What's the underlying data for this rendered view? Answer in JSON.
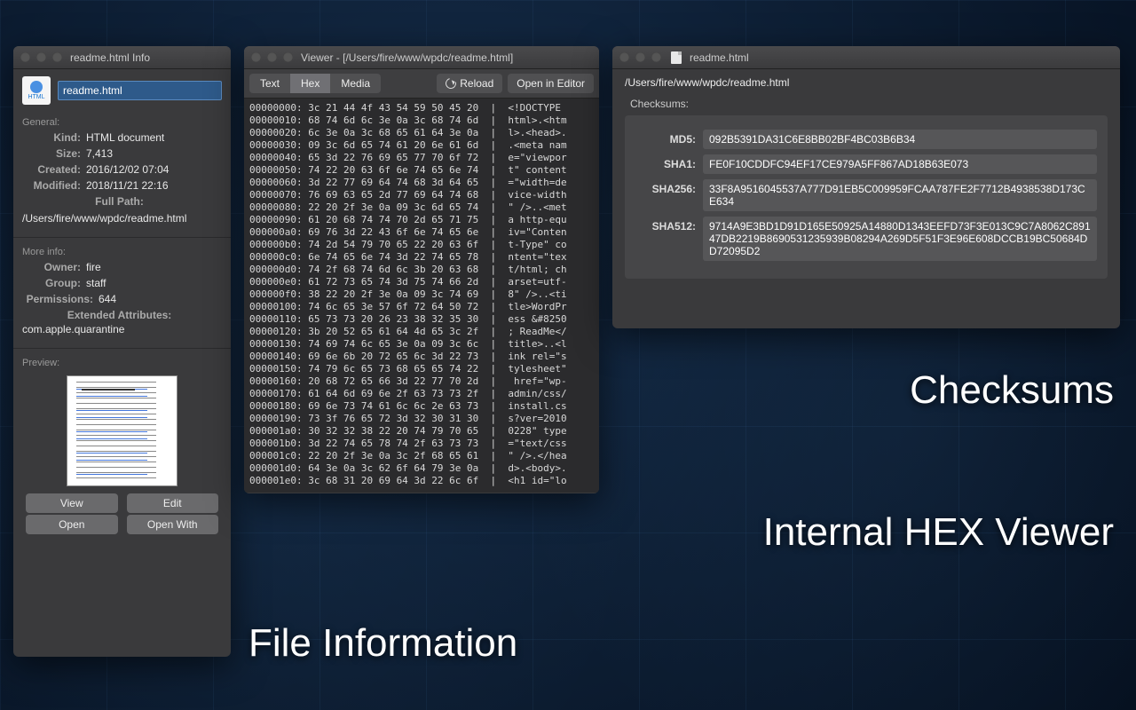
{
  "info": {
    "title": "readme.html Info",
    "filename": "readme.html",
    "iconLabel": "HTML",
    "sections": {
      "general": "General:",
      "moreinfo": "More info:",
      "preview": "Preview:"
    },
    "kind": {
      "label": "Kind:",
      "value": "HTML document"
    },
    "size": {
      "label": "Size:",
      "value": "7,413"
    },
    "created": {
      "label": "Created:",
      "value": "2016/12/02 07:04"
    },
    "modified": {
      "label": "Modified:",
      "value": "2018/11/21 22:16"
    },
    "fullpathLabel": "Full Path:",
    "fullpath": "/Users/fire/www/wpdc/readme.html",
    "owner": {
      "label": "Owner:",
      "value": "fire"
    },
    "group": {
      "label": "Group:",
      "value": "staff"
    },
    "permissions": {
      "label": "Permissions:",
      "value": "644"
    },
    "extattrLabel": "Extended Attributes:",
    "extattr": "com.apple.quarantine",
    "buttons": {
      "view": "View",
      "edit": "Edit",
      "open": "Open",
      "openwith": "Open With"
    }
  },
  "viewer": {
    "title": "Viewer - [/Users/fire/www/wpdc/readme.html]",
    "tabs": {
      "text": "Text",
      "hex": "Hex",
      "media": "Media"
    },
    "reload": "Reload",
    "openInEditor": "Open in Editor",
    "hex": "00000000: 3c 21 44 4f 43 54 59 50 45 20  |  <!DOCTYPE \n00000010: 68 74 6d 6c 3e 0a 3c 68 74 6d  |  html>.<htm\n00000020: 6c 3e 0a 3c 68 65 61 64 3e 0a  |  l>.<head>.\n00000030: 09 3c 6d 65 74 61 20 6e 61 6d  |  .<meta nam\n00000040: 65 3d 22 76 69 65 77 70 6f 72  |  e=\"viewpor\n00000050: 74 22 20 63 6f 6e 74 65 6e 74  |  t\" content\n00000060: 3d 22 77 69 64 74 68 3d 64 65  |  =\"width=de\n00000070: 76 69 63 65 2d 77 69 64 74 68  |  vice-width\n00000080: 22 20 2f 3e 0a 09 3c 6d 65 74  |  \" />..<met\n00000090: 61 20 68 74 74 70 2d 65 71 75  |  a http-equ\n000000a0: 69 76 3d 22 43 6f 6e 74 65 6e  |  iv=\"Conten\n000000b0: 74 2d 54 79 70 65 22 20 63 6f  |  t-Type\" co\n000000c0: 6e 74 65 6e 74 3d 22 74 65 78  |  ntent=\"tex\n000000d0: 74 2f 68 74 6d 6c 3b 20 63 68  |  t/html; ch\n000000e0: 61 72 73 65 74 3d 75 74 66 2d  |  arset=utf-\n000000f0: 38 22 20 2f 3e 0a 09 3c 74 69  |  8\" />..<ti\n00000100: 74 6c 65 3e 57 6f 72 64 50 72  |  tle>WordPr\n00000110: 65 73 73 20 26 23 38 32 35 30  |  ess &#8250\n00000120: 3b 20 52 65 61 64 4d 65 3c 2f  |  ; ReadMe</\n00000130: 74 69 74 6c 65 3e 0a 09 3c 6c  |  title>..<l\n00000140: 69 6e 6b 20 72 65 6c 3d 22 73  |  ink rel=\"s\n00000150: 74 79 6c 65 73 68 65 65 74 22  |  tylesheet\"\n00000160: 20 68 72 65 66 3d 22 77 70 2d  |   href=\"wp-\n00000170: 61 64 6d 69 6e 2f 63 73 73 2f  |  admin/css/\n00000180: 69 6e 73 74 61 6c 6c 2e 63 73  |  install.cs\n00000190: 73 3f 76 65 72 3d 32 30 31 30  |  s?ver=2010\n000001a0: 30 32 32 38 22 20 74 79 70 65  |  0228\" type\n000001b0: 3d 22 74 65 78 74 2f 63 73 73  |  =\"text/css\n000001c0: 22 20 2f 3e 0a 3c 2f 68 65 61  |  \" />.</hea\n000001d0: 64 3e 0a 3c 62 6f 64 79 3e 0a  |  d>.<body>.\n000001e0: 3c 68 31 20 69 64 3d 22 6c 6f  |  <h1 id=\"lo"
  },
  "checksum": {
    "title": "readme.html",
    "path": "/Users/fire/www/wpdc/readme.html",
    "heading": "Checksums:",
    "rows": {
      "md5": {
        "label": "MD5:",
        "value": "092B5391DA31C6E8BB02BF4BC03B6B34"
      },
      "sha1": {
        "label": "SHA1:",
        "value": "FE0F10CDDFC94EF17CE979A5FF867AD18B63E073"
      },
      "sha256": {
        "label": "SHA256:",
        "value": "33F8A9516045537A777D91EB5C009959FCAA787FE2F7712B4938538D173CE634"
      },
      "sha512": {
        "label": "SHA512:",
        "value": "9714A9E3BD1D91D165E50925A14880D1343EEFD73F3E013C9C7A8062C89147DB2219B8690531235939B08294A269D5F51F3E96E608DCCB19BC50684DD72095D2"
      }
    }
  },
  "labels": {
    "checksums": "Checksums",
    "hexviewer": "Internal HEX Viewer",
    "fileinfo": "File Information"
  }
}
